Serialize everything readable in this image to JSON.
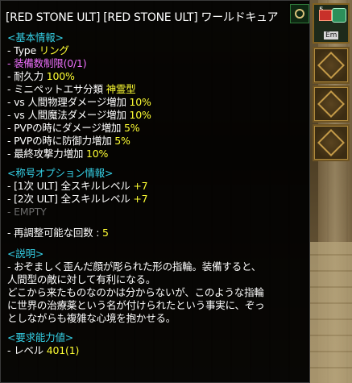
{
  "tooltip": {
    "title": "[RED STONE ULT] [RED STONE ULT] ワールドキュア",
    "sections": {
      "basic_header": "<基本情報>",
      "type_label": "- Type ",
      "type_value": "リング",
      "equip_limit": "- 装備数制限(0/1)",
      "durability_label": "- 耐久力 ",
      "durability_value": "100%",
      "minipet_label": "- ミニペットエサ分類 ",
      "minipet_value": "神霊型",
      "stat1_label": "- vs 人間物理ダメージ増加 ",
      "stat1_value": "10%",
      "stat2_label": "- vs 人間魔法ダメージ増加 ",
      "stat2_value": "10%",
      "stat3_label": "- PVPの時にダメージ増加 ",
      "stat3_value": "5%",
      "stat4_label": "- PVPの時に防御力増加 ",
      "stat4_value": "5%",
      "stat5_label": "- 最終攻撃力増加 ",
      "stat5_value": "10%",
      "title_option_header": "<称号オプション情報>",
      "opt1_label": "- [1次 ULT] 全スキルレベル ",
      "opt1_value": "+7",
      "opt2_label": "- [2次 ULT] 全スキルレベル ",
      "opt2_value": "+7",
      "opt3": "- EMPTY",
      "readjust_label": "- 再調整可能な回数 : ",
      "readjust_value": "5",
      "desc_header": "<説明>",
      "desc1": "- おぞましく歪んだ顔が彫られた形の指輪。装備すると、",
      "desc2": "人間型の敵に対して有利になる。",
      "desc3": "どこから来たものなのかは分からないが、このような指輪",
      "desc4": "に世界の治療薬という名が付けられたという事実に、ぞっ",
      "desc5": "としながらも複雑な心境を抱かせる。",
      "req_header": "<要求能力値>",
      "req_label": "- レベル ",
      "req_value": "401(1)"
    }
  },
  "side": {
    "slot_top_number": "5",
    "slot_top_tag": "Em"
  },
  "colors": {
    "header": "#35d0e6",
    "value": "#ffff33",
    "limit": "#f070ff",
    "empty": "#6a6a6a",
    "text": "#ffffff"
  },
  "icons": [
    "ring-icon",
    "gem-icon",
    "diamond-slot-icon"
  ]
}
